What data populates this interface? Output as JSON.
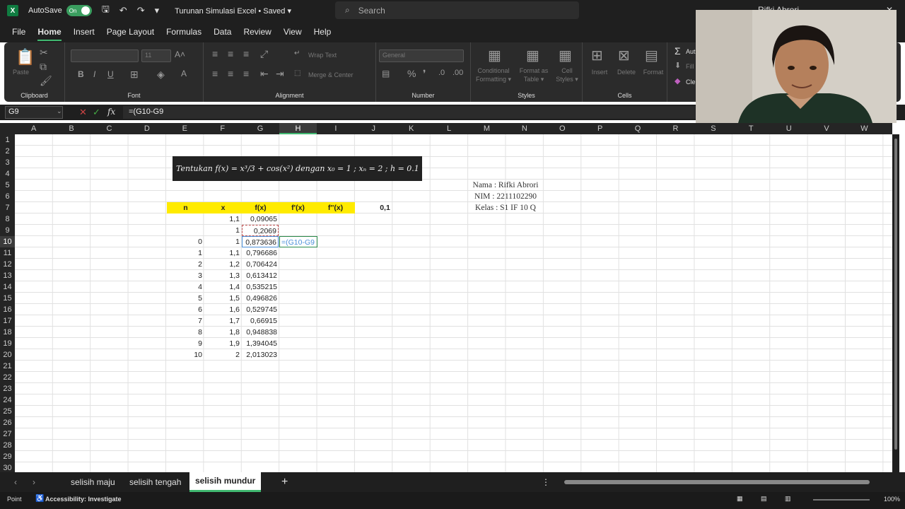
{
  "titlebar": {
    "app_icon": "X",
    "autosave": "AutoSave",
    "toggle": "On",
    "title": "Turunan Simulasi Excel • Saved ▾",
    "search": "Search",
    "user": "Rifki Abrori"
  },
  "menu": [
    "File",
    "Home",
    "Insert",
    "Page Layout",
    "Formulas",
    "Data",
    "Review",
    "View",
    "Help"
  ],
  "ribbon": {
    "paste": "Paste",
    "clipboard": "Clipboard",
    "font_size": "11",
    "font": "Font",
    "wrap": "Wrap Text",
    "merge": "Merge & Center",
    "alignment": "Alignment",
    "numfmt": "General",
    "number": "Number",
    "cond": "Conditional Formatting ▾",
    "fmt_table": "Format as Table ▾",
    "cell_styles": "Cell Styles ▾",
    "styles": "Styles",
    "insert": "Insert",
    "delete": "Delete",
    "format": "Format",
    "cells": "Cells",
    "autosum": "Aut",
    "fill": "Fill",
    "clear": "Cle"
  },
  "formula_bar": {
    "cell": "G9",
    "formula": "=(G10-G9"
  },
  "columns": [
    "A",
    "B",
    "C",
    "D",
    "E",
    "F",
    "G",
    "H",
    "I",
    "J",
    "K",
    "L",
    "M",
    "N",
    "O",
    "P",
    "Q",
    "R",
    "S",
    "T",
    "U",
    "V",
    "W"
  ],
  "rows": [
    "1",
    "2",
    "3",
    "4",
    "5",
    "6",
    "7",
    "8",
    "9",
    "10",
    "11",
    "12",
    "13",
    "14",
    "15",
    "16",
    "17",
    "18",
    "19",
    "20",
    "21",
    "22",
    "23",
    "24",
    "25",
    "26",
    "27",
    "28",
    "29",
    "30"
  ],
  "equation": "Tentukan f(x) = x³/3 + cos(x²)  dengan x₀ = 1 ; xₙ = 2 ; h = 0.1",
  "headers": {
    "n": "n",
    "x": "x",
    "fx": "f(x)",
    "d1": "f'(x)",
    "d2": "f''(x)",
    "h": "0,1"
  },
  "table": [
    {
      "n": "",
      "x": "1,1",
      "fx": "0,09065"
    },
    {
      "n": "",
      "x": "1",
      "fx": "0,2069"
    },
    {
      "n": "0",
      "x": "1",
      "fx": "0,873636",
      "edit": "=(G10-G9"
    },
    {
      "n": "1",
      "x": "1,1",
      "fx": "0,796686"
    },
    {
      "n": "2",
      "x": "1,2",
      "fx": "0,706424"
    },
    {
      "n": "3",
      "x": "1,3",
      "fx": "0,613412"
    },
    {
      "n": "4",
      "x": "1,4",
      "fx": "0,535215"
    },
    {
      "n": "5",
      "x": "1,5",
      "fx": "0,496826"
    },
    {
      "n": "6",
      "x": "1,6",
      "fx": "0,529745"
    },
    {
      "n": "7",
      "x": "1,7",
      "fx": "0,66915"
    },
    {
      "n": "8",
      "x": "1,8",
      "fx": "0,948838"
    },
    {
      "n": "9",
      "x": "1,9",
      "fx": "1,394045"
    },
    {
      "n": "10",
      "x": "2",
      "fx": "2,013023"
    }
  ],
  "info": {
    "nama": "Nama : Rifki Abrori",
    "nim": "NIM : 2211102290",
    "kelas": "Kelas : S1 IF 10 Q"
  },
  "sheets": [
    "selisih maju",
    "selisih tengah",
    "selisih mundur"
  ],
  "status": {
    "mode": "Point",
    "access": "Accessibility: Investigate",
    "zoom": "100%"
  }
}
